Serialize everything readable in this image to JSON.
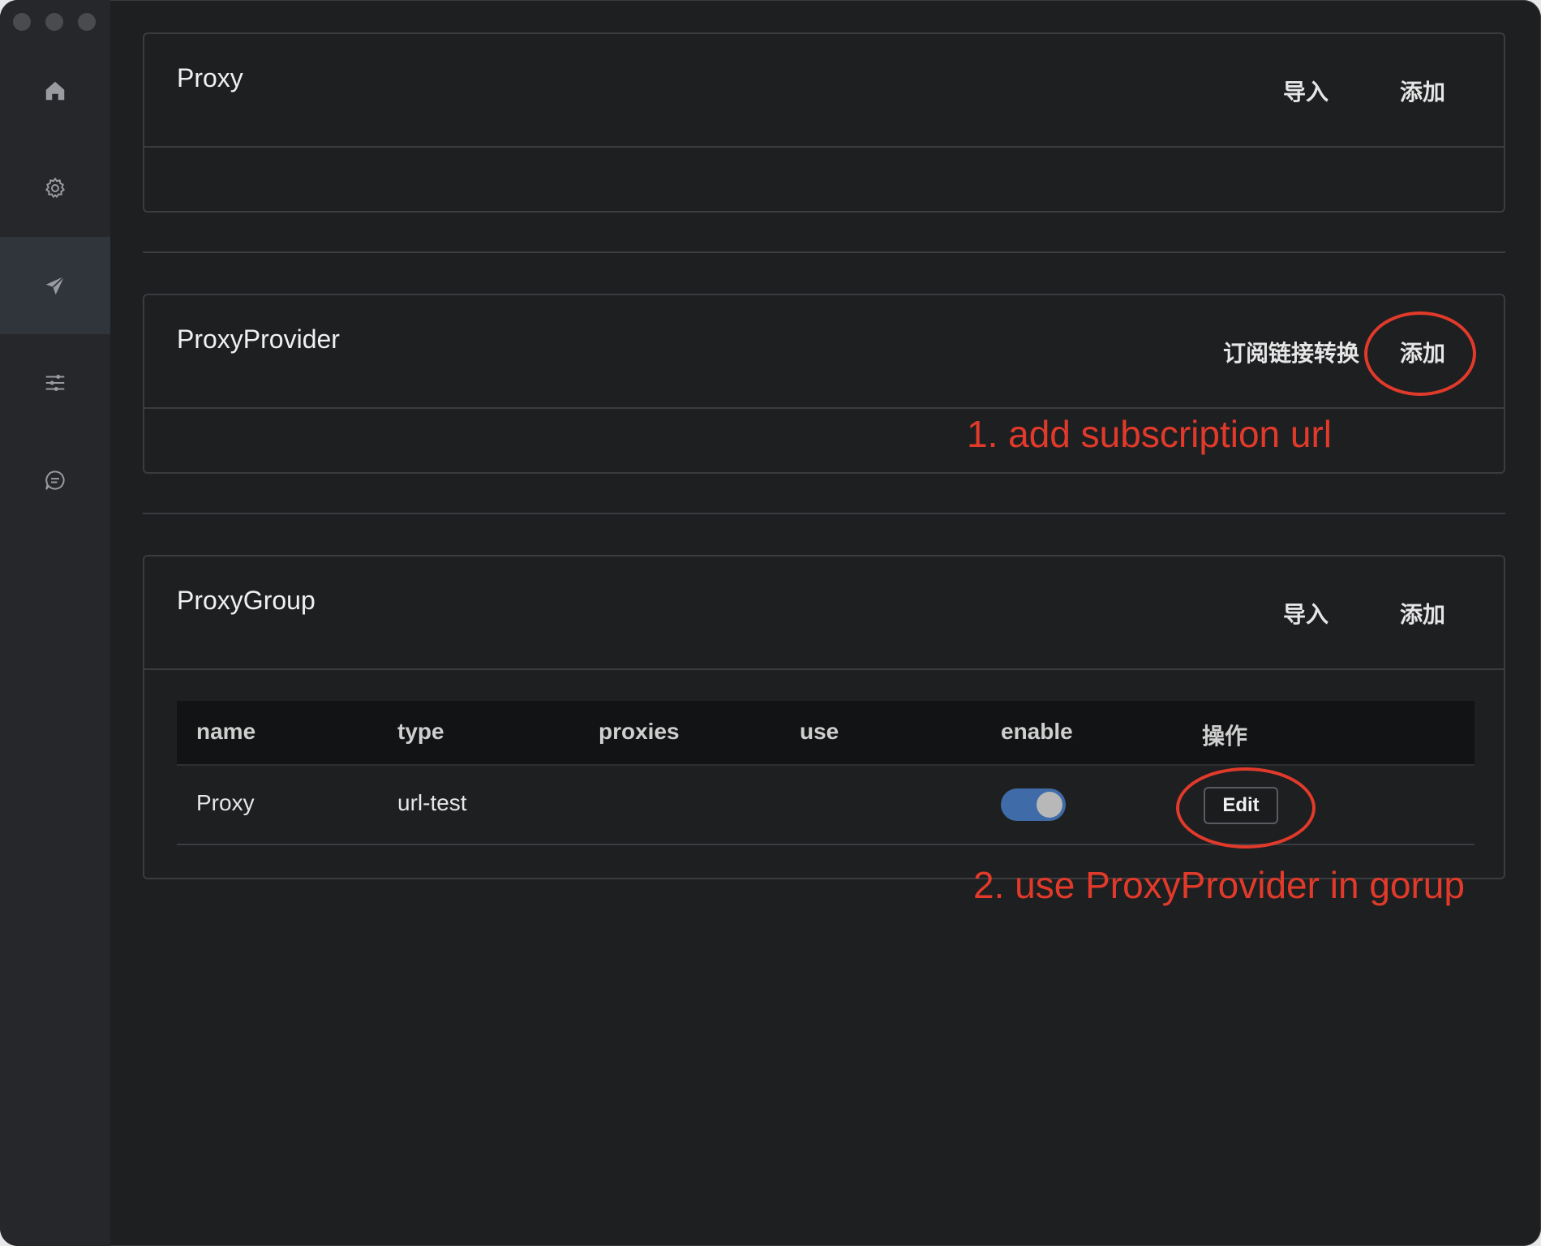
{
  "nav": {
    "items": [
      {
        "icon": "home-icon"
      },
      {
        "icon": "gear-icon"
      },
      {
        "icon": "send-icon",
        "active": true
      },
      {
        "icon": "sliders-icon"
      },
      {
        "icon": "chat-icon"
      }
    ]
  },
  "proxy_section": {
    "title": "Proxy",
    "import_label": "导入",
    "add_label": "添加"
  },
  "provider_section": {
    "title": "ProxyProvider",
    "convert_label": "订阅链接转换",
    "add_label": "添加"
  },
  "group_section": {
    "title": "ProxyGroup",
    "import_label": "导入",
    "add_label": "添加",
    "columns": [
      "name",
      "type",
      "proxies",
      "use",
      "enable",
      "操作"
    ],
    "rows": [
      {
        "name": "Proxy",
        "type": "url-test",
        "proxies": "",
        "use": "",
        "enabled": true,
        "edit_label": "Edit"
      }
    ]
  },
  "annotations": {
    "step1": "1.  add subscription url",
    "step2": "2.  use  ProxyProvider in gorup"
  },
  "colors": {
    "accent": "#3f6ca8",
    "annotation": "#e23a2a"
  }
}
